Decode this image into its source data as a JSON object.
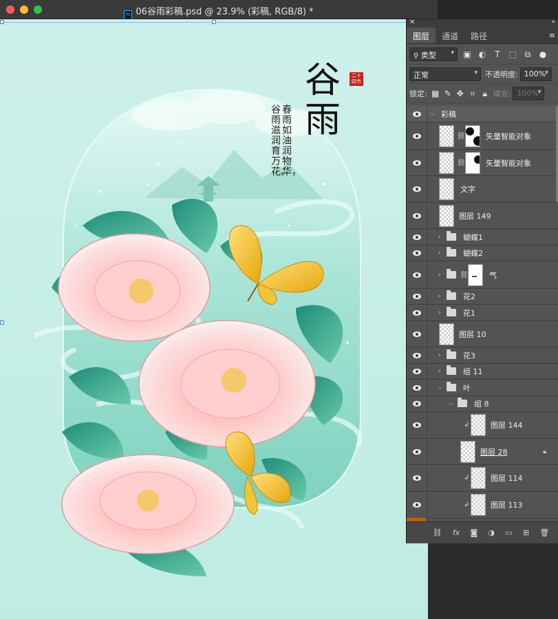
{
  "window": {
    "title": "06谷雨彩稿.psd @ 23.9% (彩稿, RGB/8) *",
    "file_icon_text": "Ps"
  },
  "poster": {
    "title_char_1": "谷",
    "title_char_2": "雨",
    "line_1": "春雨如油润物华，",
    "line_2": "谷雨滋润育万花。",
    "seal_text": "二十四节气"
  },
  "panel": {
    "tabs": [
      {
        "label": "图层",
        "active": true
      },
      {
        "label": "通道",
        "active": false
      },
      {
        "label": "路径",
        "active": false
      }
    ],
    "filter_type": "类型",
    "blend_mode": "正常",
    "opacity_label": "不透明度:",
    "opacity_value": "100%",
    "lock_label": "锁定:",
    "fill_label": "填充:",
    "fill_value": "100%",
    "layers": [
      {
        "name": "彩稿",
        "kind": "group-open"
      },
      {
        "name": "矢量智能对象",
        "kind": "smart-mask"
      },
      {
        "name": "矢量智能对象",
        "kind": "smart-mask"
      },
      {
        "name": "文字",
        "kind": "smart"
      },
      {
        "name": "图层 149",
        "kind": "pixel"
      },
      {
        "name": "蝴蝶1",
        "kind": "group"
      },
      {
        "name": "蝴蝶2",
        "kind": "group"
      },
      {
        "name": "气",
        "kind": "group-mask"
      },
      {
        "name": "花2",
        "kind": "group"
      },
      {
        "name": "花1",
        "kind": "group"
      },
      {
        "name": "图层 10",
        "kind": "pixel"
      },
      {
        "name": "花3",
        "kind": "group"
      },
      {
        "name": "组 11",
        "kind": "group"
      },
      {
        "name": "叶",
        "kind": "group-expanded"
      },
      {
        "name": "组 8",
        "kind": "group-expanded-nested"
      },
      {
        "name": "图层 144",
        "kind": "clipped"
      },
      {
        "name": "图层 28",
        "kind": "pixel-locked"
      },
      {
        "name": "图层 114",
        "kind": "clipped"
      },
      {
        "name": "图层 113",
        "kind": "clipped"
      }
    ]
  },
  "icons": {
    "link": "link-icon",
    "fx": "fx-icon",
    "mask": "add-mask-icon",
    "adjust": "adjustment-icon",
    "new_group": "new-group-icon",
    "new_layer": "new-layer-icon",
    "delete": "trash-icon"
  },
  "colors": {
    "canvas_bg": "#c6efe6",
    "panel_bg": "#535353",
    "accent_blue": "#31a8ff",
    "seal_red": "#c8201f"
  }
}
